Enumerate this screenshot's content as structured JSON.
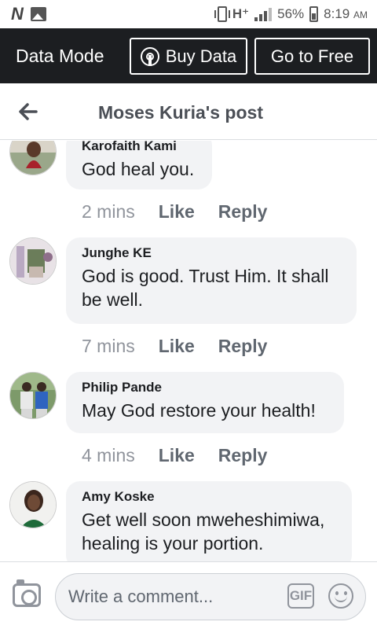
{
  "status_bar": {
    "logo_letter": "N",
    "network_type": "H⁺",
    "battery": "56%",
    "time": "8:19",
    "time_suffix": "AM"
  },
  "data_bar": {
    "label": "Data Mode",
    "buy_label": "Buy Data",
    "free_label": "Go to Free"
  },
  "header": {
    "title": "Moses Kuria's post"
  },
  "comments": [
    {
      "author": "Karofaith Kami",
      "text": "God heal you.",
      "time": "2 mins",
      "like": "Like",
      "reply": "Reply"
    },
    {
      "author": "Junghe KE",
      "text": "God is good. Trust Him. It shall be well.",
      "time": "7 mins",
      "like": "Like",
      "reply": "Reply"
    },
    {
      "author": "Philip Pande",
      "text": "May God restore your health!",
      "time": "4 mins",
      "like": "Like",
      "reply": "Reply"
    },
    {
      "author": "Amy Koske",
      "text": "Get well soon mweheshimiwa, healing is your portion.",
      "time": "",
      "like": "",
      "reply": ""
    }
  ],
  "composer": {
    "placeholder": "Write a comment...",
    "gif_label": "GIF"
  }
}
